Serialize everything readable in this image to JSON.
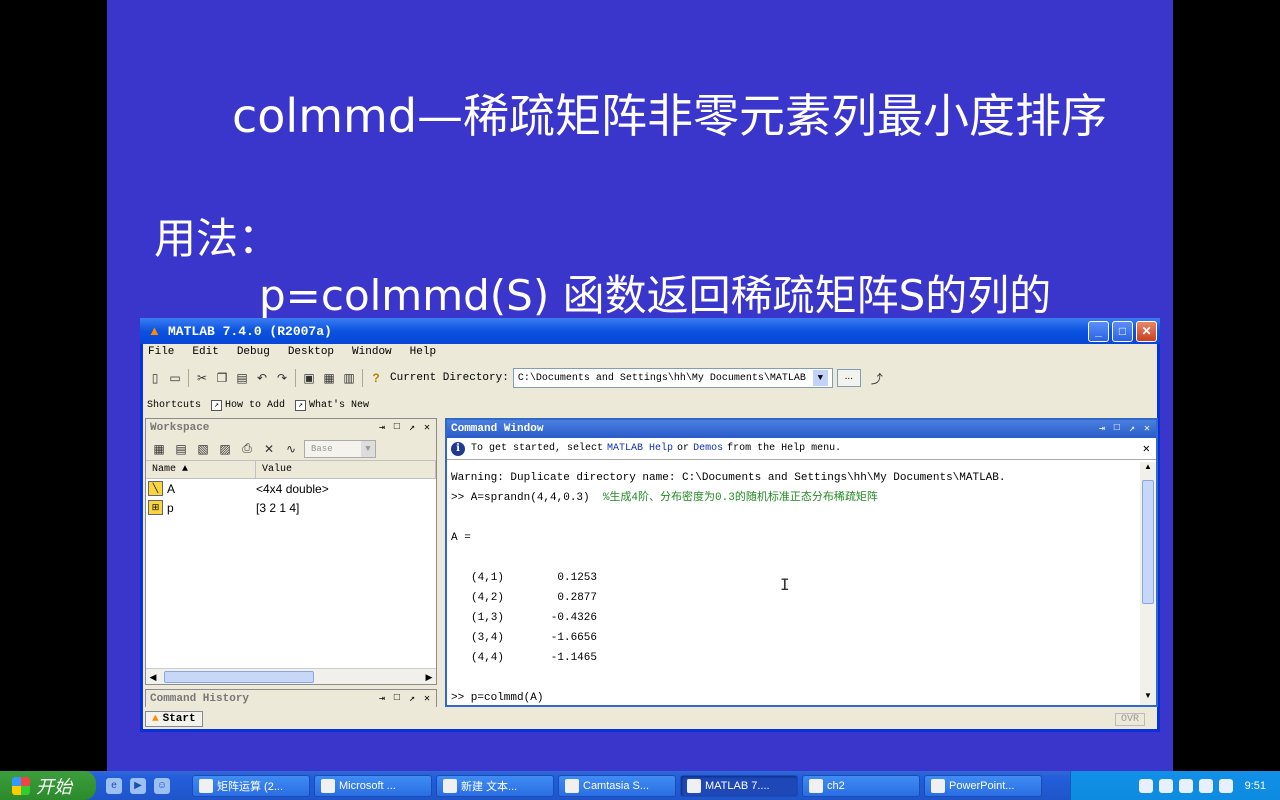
{
  "slide": {
    "title": "colmmd—稀疏矩阵非零元素列最小度排序",
    "usage_label": "用法：",
    "usage_line": "p=colmmd(S)    函数返回稀疏矩阵S的列的"
  },
  "matlab": {
    "title": "MATLAB  7.4.0 (R2007a)",
    "menu": [
      "File",
      "Edit",
      "Debug",
      "Desktop",
      "Window",
      "Help"
    ],
    "current_dir_label": "Current Directory:",
    "current_dir_value": "C:\\Documents and Settings\\hh\\My Documents\\MATLAB",
    "browse_label": "...",
    "shortcuts": {
      "label": "Shortcuts",
      "how_to_add": "How to Add",
      "whats_new": "What's New"
    },
    "workspace": {
      "title": "Workspace",
      "base": "Base",
      "col_name": "Name ▲",
      "col_value": "Value",
      "rows": [
        {
          "name": "A",
          "value": "<4x4 double>"
        },
        {
          "name": "p",
          "value": "[3 2 1 4]"
        }
      ]
    },
    "command_history_title": "Command History",
    "command_window": {
      "title": "Command Window",
      "info_pre": "To get started, select",
      "info_link1": "MATLAB Help",
      "info_or": "or",
      "info_link2": "Demos",
      "info_post": "from the Help menu.",
      "warning": "Warning: Duplicate directory name: C:\\Documents and Settings\\hh\\My Documents\\MATLAB.",
      "cmd1": ">> A=sprandn(4,4,0.3)  ",
      "cmd1_comment": "%生成4阶、分布密度为0.3的随机标准正态分布稀疏矩阵",
      "a_eq": "A =",
      "entries": [
        {
          "idx": "(4,1)",
          "val": "0.1253"
        },
        {
          "idx": "(4,2)",
          "val": "0.2877"
        },
        {
          "idx": "(1,3)",
          "val": "-0.4326"
        },
        {
          "idx": "(3,4)",
          "val": "-1.6656"
        },
        {
          "idx": "(4,4)",
          "val": "-1.1465"
        }
      ],
      "cmd2": ">> p=colmmd(A)"
    },
    "start_label": "Start",
    "ovr": "OVR"
  },
  "taskbar": {
    "start_label": "开始",
    "tasks": [
      "矩阵运算 (2...",
      "Microsoft ...",
      "新建 文本...",
      "Camtasia S...",
      "MATLAB  7....",
      "ch2",
      "PowerPoint..."
    ],
    "clock": "9:51"
  }
}
